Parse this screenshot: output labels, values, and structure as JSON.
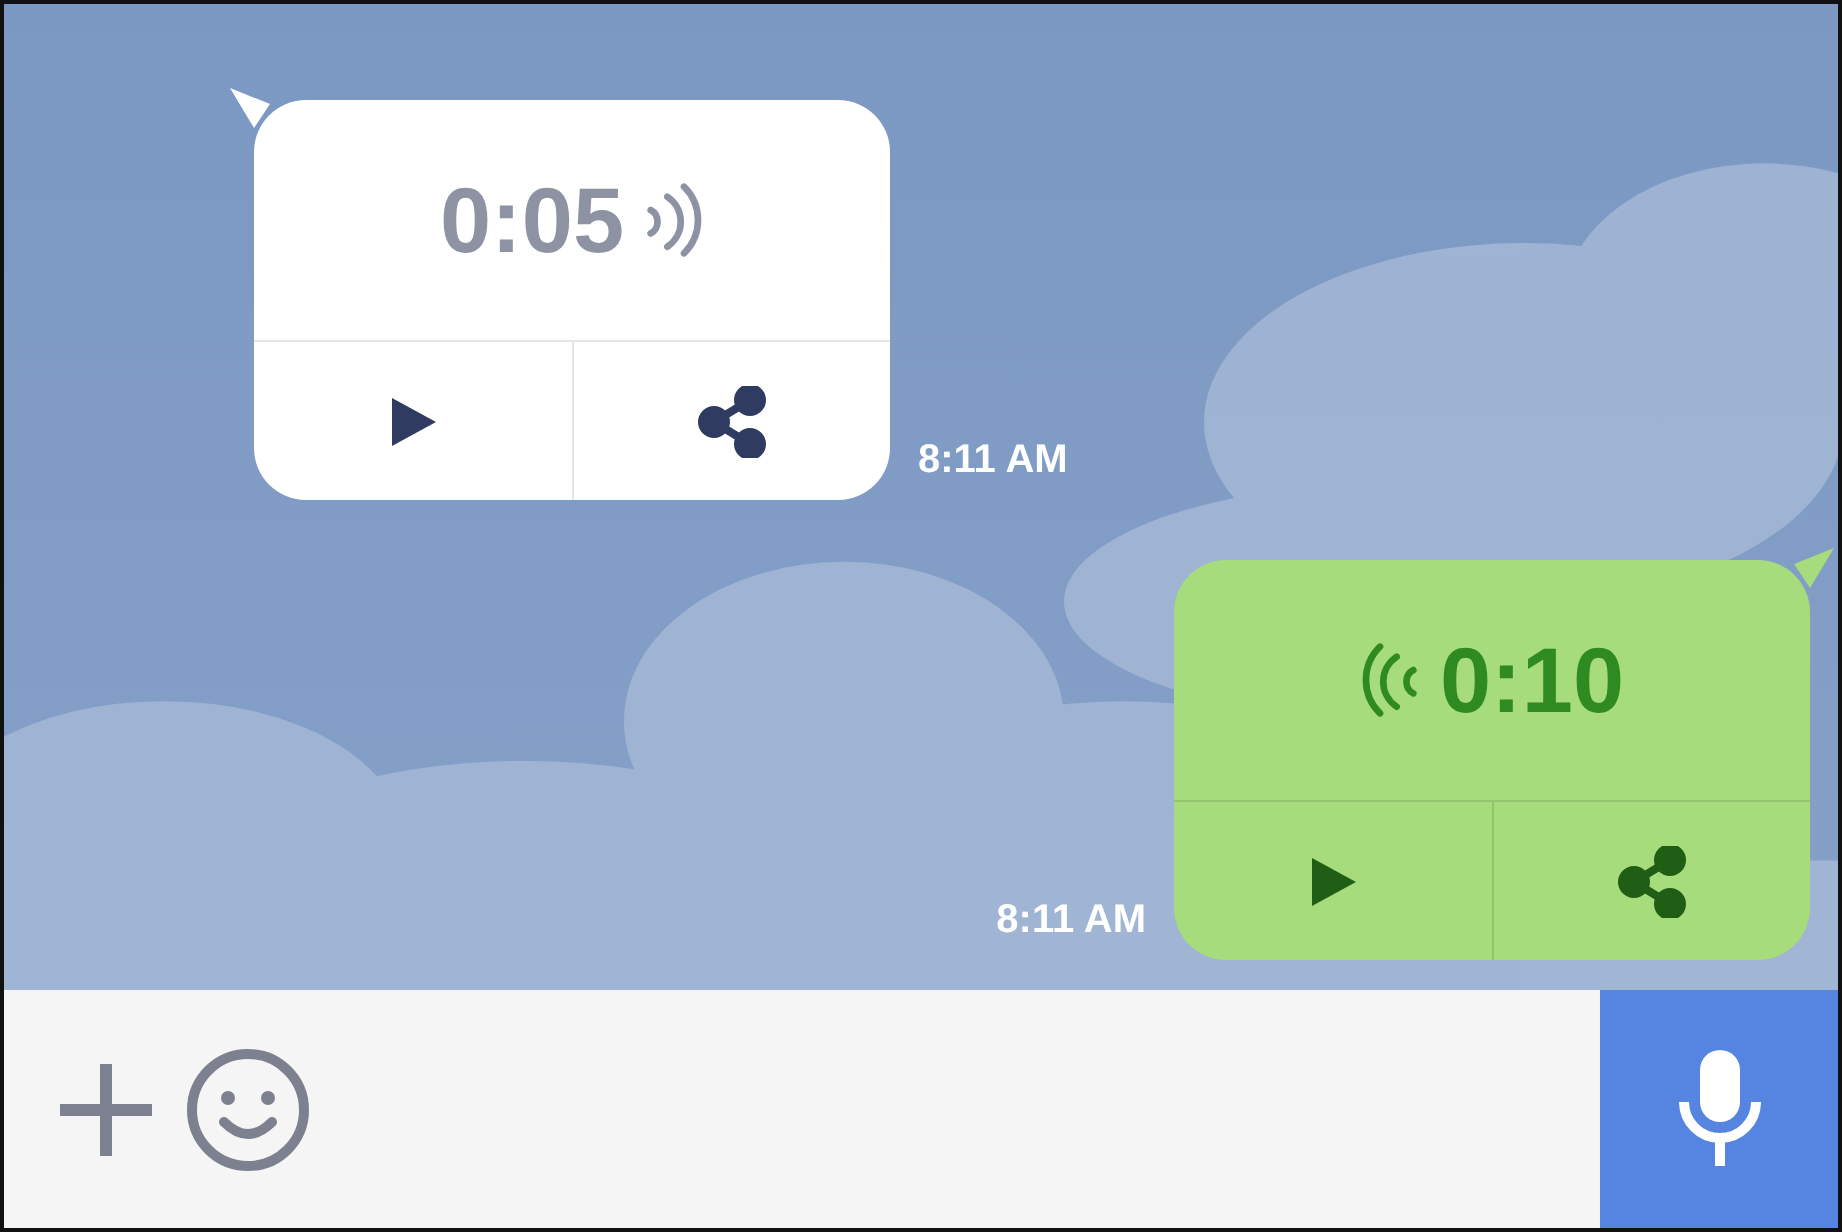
{
  "messages": [
    {
      "kind": "received",
      "duration": "0:05",
      "time": "8:11 AM"
    },
    {
      "kind": "sent",
      "duration": "0:10",
      "time": "8:11 AM"
    }
  ]
}
